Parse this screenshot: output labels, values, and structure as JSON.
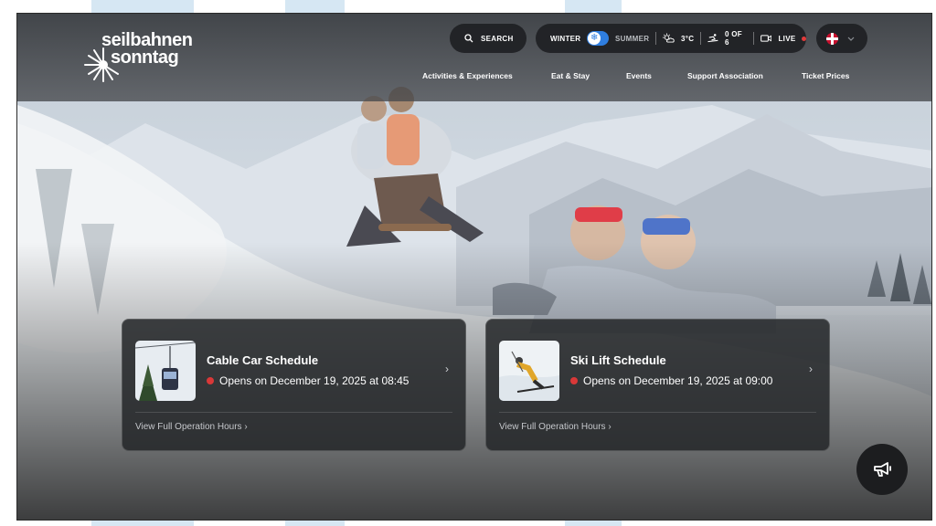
{
  "brand": {
    "logo_line1": "seilbahnen",
    "logo_line2": "sonntag"
  },
  "header": {
    "search_label": "SEARCH",
    "season": {
      "winter_label": "WINTER",
      "summer_label": "SUMMER",
      "active": "winter"
    },
    "weather": {
      "temperature": "3°C"
    },
    "lifts": {
      "open_count": "0 OF 6"
    },
    "live_label": "LIVE",
    "language": {
      "flag": "uk-flag-icon"
    }
  },
  "nav": {
    "items": [
      {
        "label": "Activities & Experiences"
      },
      {
        "label": "Eat & Stay"
      },
      {
        "label": "Events"
      },
      {
        "label": "Support Association"
      },
      {
        "label": "Ticket Prices"
      }
    ]
  },
  "cards": [
    {
      "title": "Cable Car Schedule",
      "status": "Opens on December 19, 2025 at 08:45",
      "link": "View Full Operation Hours",
      "chevron": "›"
    },
    {
      "title": "Ski Lift Schedule",
      "status": "Opens on December 19, 2025 at 09:00",
      "link": "View Full Operation Hours",
      "chevron": "›"
    }
  ],
  "colors": {
    "accent_toggle": "#2f7ee0",
    "status_closed": "#d93838",
    "live_dot": "#e23b3b",
    "pill_bg": "#1c1e21",
    "page_watermark": "#d6e7f3"
  }
}
